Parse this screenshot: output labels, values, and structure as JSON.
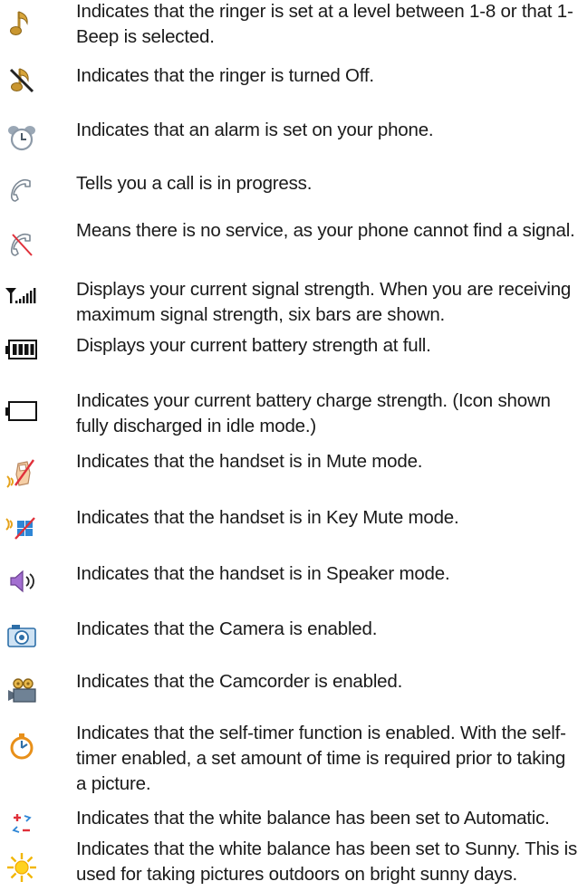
{
  "rows": [
    {
      "icon": "ringer-note-icon",
      "text": "Indicates that the ringer is set at a level between 1-8 or that 1-Beep is selected."
    },
    {
      "icon": "ringer-off-icon",
      "text": "Indicates that the ringer is turned Off."
    },
    {
      "icon": "alarm-clock-icon",
      "text": "Indicates that an alarm is set on your phone."
    },
    {
      "icon": "call-in-progress-icon",
      "text": "Tells you a call is in progress."
    },
    {
      "icon": "no-service-icon",
      "text": "Means there is no service, as your phone cannot find a signal."
    },
    {
      "icon": "signal-strength-icon",
      "text": "Displays your current signal strength. When you are receiving maximum signal strength, six bars are shown."
    },
    {
      "icon": "battery-full-icon",
      "text": "Displays your current battery strength at full."
    },
    {
      "icon": "battery-empty-icon",
      "text": "Indicates your current battery charge strength. (Icon shown fully discharged in idle mode.)"
    },
    {
      "icon": "mute-mode-icon",
      "text": "Indicates that the handset is in Mute mode."
    },
    {
      "icon": "key-mute-icon",
      "text": "Indicates that the handset is in Key Mute mode."
    },
    {
      "icon": "speaker-icon",
      "text": "Indicates that the handset is in Speaker mode."
    },
    {
      "icon": "camera-icon",
      "text": "Indicates that the Camera is enabled."
    },
    {
      "icon": "camcorder-icon",
      "text": "Indicates that the Camcorder is enabled."
    },
    {
      "icon": "self-timer-icon",
      "text": "Indicates that the self-timer function is enabled. With the self-timer enabled, a set amount of time is required prior to taking a picture."
    },
    {
      "icon": "white-balance-auto-icon",
      "text": "Indicates that the white balance has been set to Automatic."
    },
    {
      "icon": "white-balance-sunny-icon",
      "text": "Indicates that the white balance has been set to Sunny. This is used for taking pictures outdoors on bright sunny days."
    }
  ]
}
